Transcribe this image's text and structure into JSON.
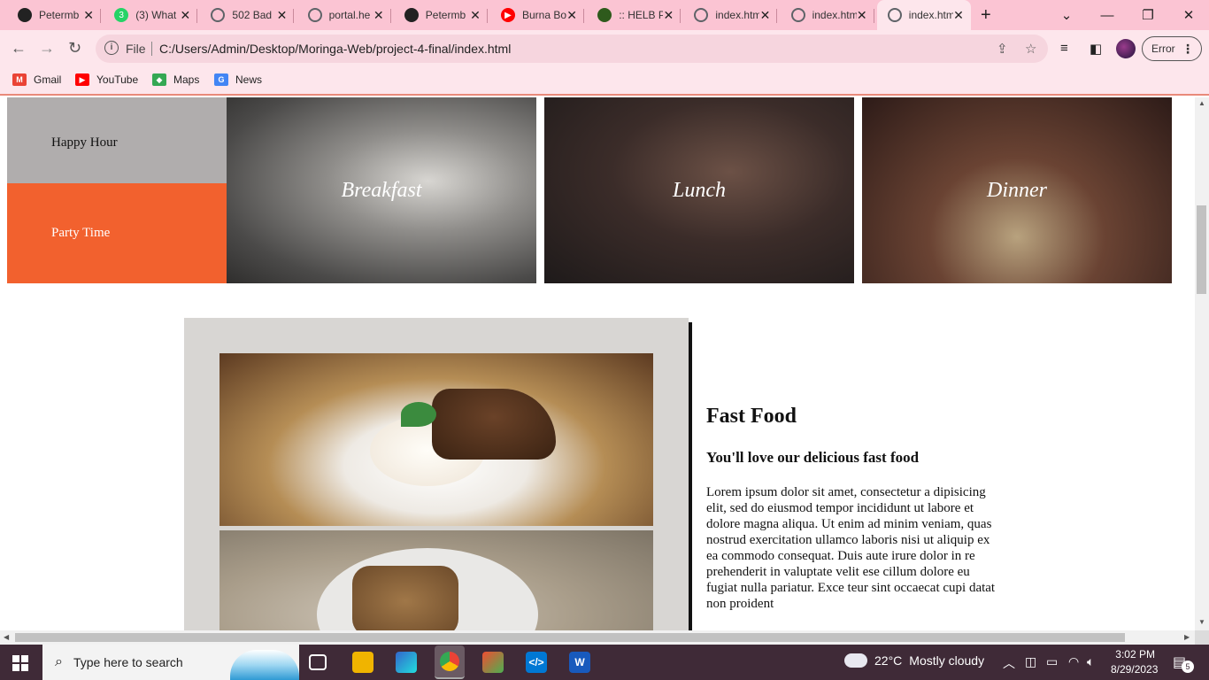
{
  "browser": {
    "tabs": [
      {
        "title": "Petermb",
        "icon": "github-icon",
        "color": "#222222",
        "glyph": ""
      },
      {
        "title": "(3) What",
        "icon": "whatsapp-icon",
        "color": "#25d366",
        "glyph": "3"
      },
      {
        "title": "502 Bad",
        "icon": "globe-icon",
        "color": "#5f6368",
        "glyph": ""
      },
      {
        "title": "portal.he",
        "icon": "globe-icon",
        "color": "#5f6368",
        "glyph": ""
      },
      {
        "title": "Petermb",
        "icon": "github-icon",
        "color": "#222222",
        "glyph": ""
      },
      {
        "title": "Burna Bo",
        "icon": "youtube-icon",
        "color": "#ff0000",
        "glyph": "▶"
      },
      {
        "title": ":: HELB P",
        "icon": "helb-icon",
        "color": "#2e5a1c",
        "glyph": ""
      },
      {
        "title": "index.htm",
        "icon": "globe-icon",
        "color": "#5f6368",
        "glyph": ""
      },
      {
        "title": "index.htm",
        "icon": "globe-icon",
        "color": "#5f6368",
        "glyph": ""
      },
      {
        "title": "index.htm",
        "icon": "globe-icon",
        "color": "#5f6368",
        "glyph": "",
        "active": true
      }
    ],
    "address": {
      "scheme": "File",
      "url": "C:/Users/Admin/Desktop/Moringa-Web/project-4-final/index.html"
    },
    "profile_status": "Error",
    "bookmarks": [
      {
        "label": "Gmail",
        "icon": "gmail-icon",
        "color": "#ea4335",
        "glyph": "M"
      },
      {
        "label": "YouTube",
        "icon": "youtube-icon",
        "color": "#ff0000",
        "glyph": "▶"
      },
      {
        "label": "Maps",
        "icon": "maps-icon",
        "color": "#34a853",
        "glyph": "◆"
      },
      {
        "label": "News",
        "icon": "news-icon",
        "color": "#4285f4",
        "glyph": "G"
      }
    ]
  },
  "page": {
    "menu": {
      "happy_hour": "Happy Hour",
      "party_time": "Party Time"
    },
    "meals": {
      "breakfast": "Breakfast",
      "lunch": "Lunch",
      "dinner": "Dinner"
    },
    "fast_food": {
      "title": "Fast Food",
      "subtitle": "You'll love our delicious fast food",
      "body": "Lorem ipsum dolor sit amet, consectetur a dipisicing elit, sed do eiusmod tempor incididunt ut labore et dolore magna aliqua. Ut enim ad minim veniam, quas nostrud exercitation ullamco laboris nisi ut aliquip ex ea commodo consequat. Duis aute irure dolor in re prehenderit in valuptate velit ese cillum dolore eu fugiat nulla pariatur. Exce teur sint occaecat cupi datat non proident"
    },
    "colors": {
      "accent_orange": "#f2612e",
      "menu_gray": "#b0adad",
      "panel_gray": "#d8d6d3"
    }
  },
  "taskbar": {
    "search_placeholder": "Type here to search",
    "weather": {
      "temp": "22°C",
      "condition": "Mostly cloudy"
    },
    "time": "3:02 PM",
    "date": "8/29/2023",
    "notifications": "5"
  }
}
